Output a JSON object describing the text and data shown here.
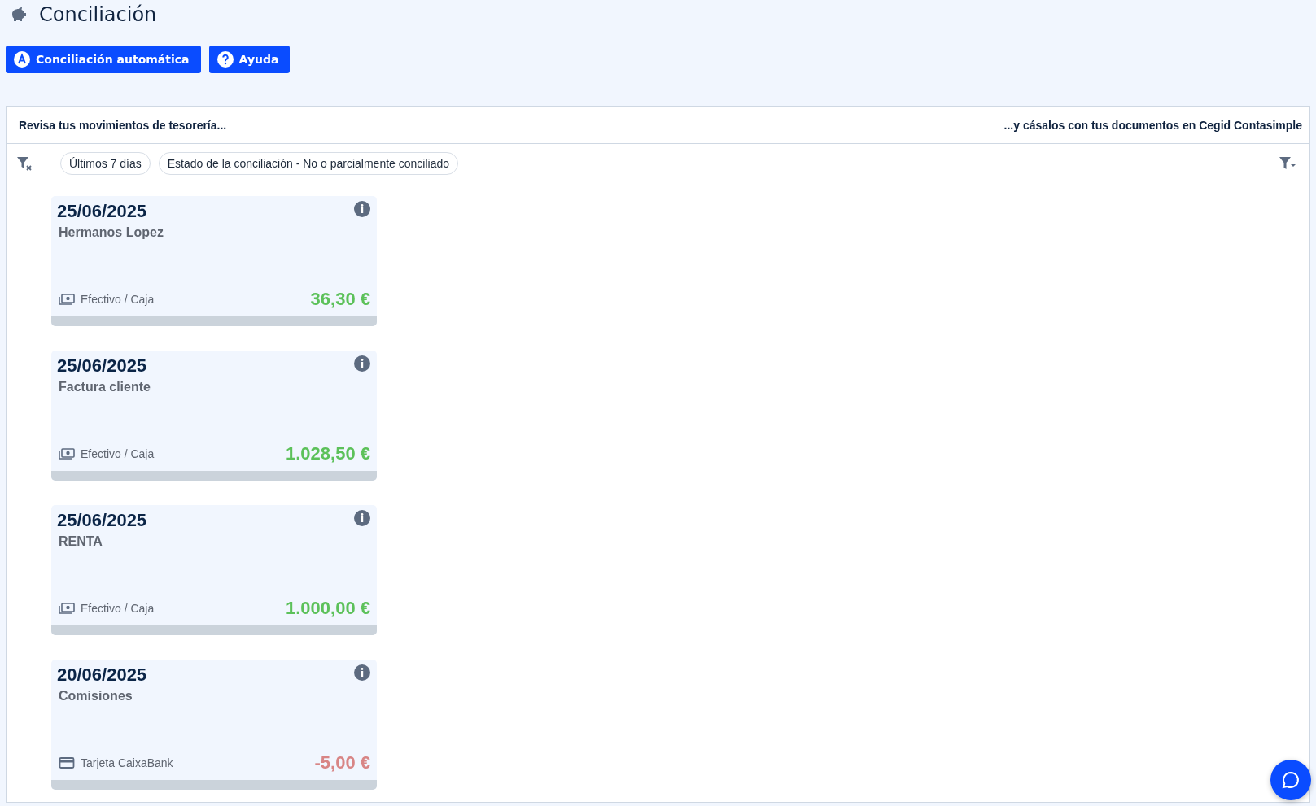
{
  "page": {
    "title": "Conciliación"
  },
  "actions": [
    {
      "label": "Conciliación automática",
      "kind": "auto"
    },
    {
      "label": "Ayuda",
      "kind": "help"
    }
  ],
  "panel": {
    "left_heading": "Revisa tus movimientos de tesorería...",
    "right_heading": "...y cásalos con tus documentos en Cegid Contasimple",
    "filters": [
      "Últimos 7 días",
      "Estado de la conciliación - No o parcialmente conciliado"
    ],
    "movements": [
      {
        "date": "25/06/2025",
        "concept": "Hermanos Lopez",
        "account": {
          "label": "Efectivo / Caja",
          "kind": "cash"
        },
        "amount": "36,30 €",
        "kind": "income"
      },
      {
        "date": "25/06/2025",
        "concept": "Factura cliente",
        "account": {
          "label": "Efectivo / Caja",
          "kind": "cash"
        },
        "amount": "1.028,50 €",
        "kind": "income"
      },
      {
        "date": "25/06/2025",
        "concept": "RENTA",
        "account": {
          "label": "Efectivo / Caja",
          "kind": "cash"
        },
        "amount": "1.000,00 €",
        "kind": "income"
      },
      {
        "date": "20/06/2025",
        "concept": "Comisiones",
        "account": {
          "label": "Tarjeta CaixaBank",
          "kind": "card"
        },
        "amount": "-5,00 €",
        "kind": "expense"
      }
    ]
  }
}
